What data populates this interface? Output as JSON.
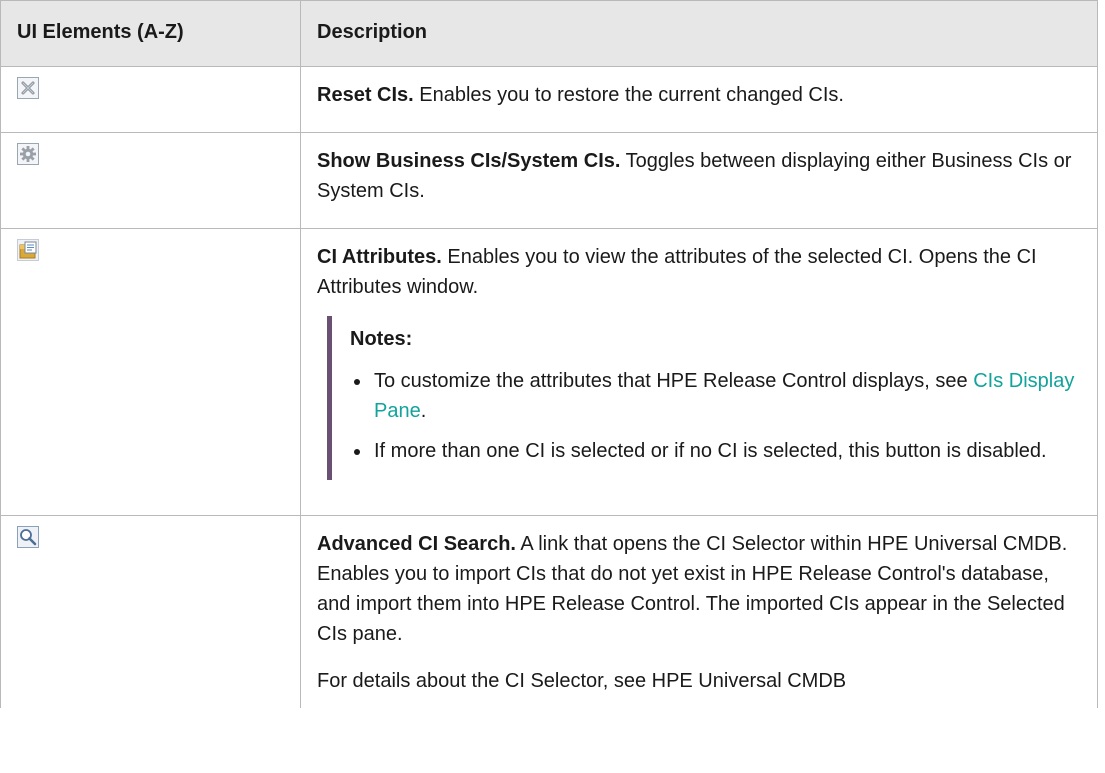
{
  "table": {
    "headers": [
      "UI Elements (A-Z)",
      "Description"
    ],
    "rows": [
      {
        "icon": "reset-x-icon",
        "title": "Reset CIs.",
        "text": " Enables you to restore the current changed CIs."
      },
      {
        "icon": "gear-icon",
        "title": "Show Business CIs/System CIs.",
        "text": " Toggles between displaying either Business CIs or System CIs."
      },
      {
        "icon": "ci-attributes-icon",
        "title": "CI Attributes.",
        "text": " Enables you to view the attributes of the selected CI. Opens the CI Attributes window.",
        "notes": {
          "title": "Notes:",
          "item1_before": "To customize the attributes that HPE Release Control displays, see ",
          "item1_link": "CIs Display Pane",
          "item1_after": ".",
          "item2": "If more than one CI is selected or if no CI is selected, this button is disabled."
        }
      },
      {
        "icon": "magnifier-icon",
        "title": "Advanced CI Search.",
        "text": " A link that opens the CI Selector within HPE Universal CMDB. Enables you to import CIs that do not yet exist in HPE Release Control's database, and import them into HPE Release Control. The imported CIs appear in the Selected CIs pane.",
        "para2": "For details about the CI Selector, see HPE Universal CMDB"
      }
    ]
  },
  "colors": {
    "header_bg": "#e7e7e7",
    "border": "#b9b9b9",
    "notes_bar": "#6a5171",
    "link": "#12a39c"
  }
}
